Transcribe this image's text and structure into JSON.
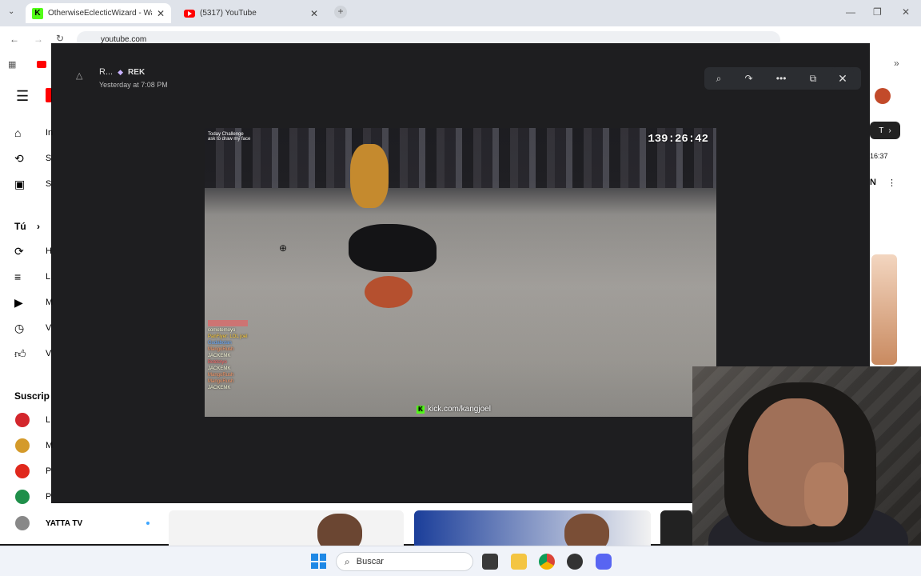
{
  "browser": {
    "tabs": [
      {
        "label": "OtherwiseEclecticWizard - Watc",
        "favicon": "kick-icon",
        "active": true
      },
      {
        "label": "(5317) YouTube",
        "favicon": "youtube-icon",
        "active": false
      }
    ],
    "address": "youtube.com",
    "window_controls": [
      "minimize",
      "maximize",
      "close"
    ]
  },
  "youtube": {
    "sidebar": [
      {
        "icon": "home-icon",
        "label": "In"
      },
      {
        "icon": "shorts-icon",
        "label": "S"
      },
      {
        "icon": "subscriptions-icon",
        "label": "S"
      },
      {
        "icon": "history-icon",
        "label": "H"
      },
      {
        "icon": "playlist-icon",
        "label": "L"
      },
      {
        "icon": "your-videos-icon",
        "label": "M"
      },
      {
        "icon": "watch-later-icon",
        "label": "V"
      },
      {
        "icon": "liked-icon",
        "label": "V"
      }
    ],
    "you_label": "Tú",
    "subscriptions_heading": "Suscrip",
    "subscriptions": [
      {
        "label": "L",
        "color": "#d3262c"
      },
      {
        "label": "M",
        "color": "#d49a2a"
      },
      {
        "label": "P",
        "color": "#e0281c"
      },
      {
        "label": "P",
        "color": "#1f8f4a"
      },
      {
        "label": "YATTA TV",
        "color": "#888888"
      }
    ],
    "right_edge": {
      "chip": "T",
      "time": "16:37",
      "letter": "N"
    }
  },
  "discord_viewer": {
    "author": "R...",
    "badge": "REK",
    "timestamp": "Yesterday at 7:08 PM",
    "toolbar": [
      "zoom-icon",
      "forward-icon",
      "more-dots-icon",
      "open-external-icon",
      "ellipsis-icon"
    ],
    "close": "✕"
  },
  "stream_image": {
    "timer": "139:26:42",
    "url": "kick.com/kangjoel",
    "caption_top": [
      "Today Challenge",
      "ask to draw my face"
    ],
    "chat": [
      "cometemoyo",
      "PanFlyer: LOL joel",
      "Gudabotan",
      "MangoRush",
      "JACKEMK",
      "Botdotyo",
      "JACKEMK",
      "MangoRush",
      "MangoRush",
      "JACKEMK"
    ]
  },
  "taskbar": {
    "search_placeholder": "Buscar",
    "icons": [
      "windows-start-icon",
      "search-icon",
      "task-view-icon",
      "file-explorer-icon",
      "chrome-icon",
      "app-icon",
      "discord-icon"
    ]
  },
  "colors": {
    "kick_green": "#53fc18",
    "youtube_red": "#ff0000",
    "discord_bg": "#060608"
  }
}
